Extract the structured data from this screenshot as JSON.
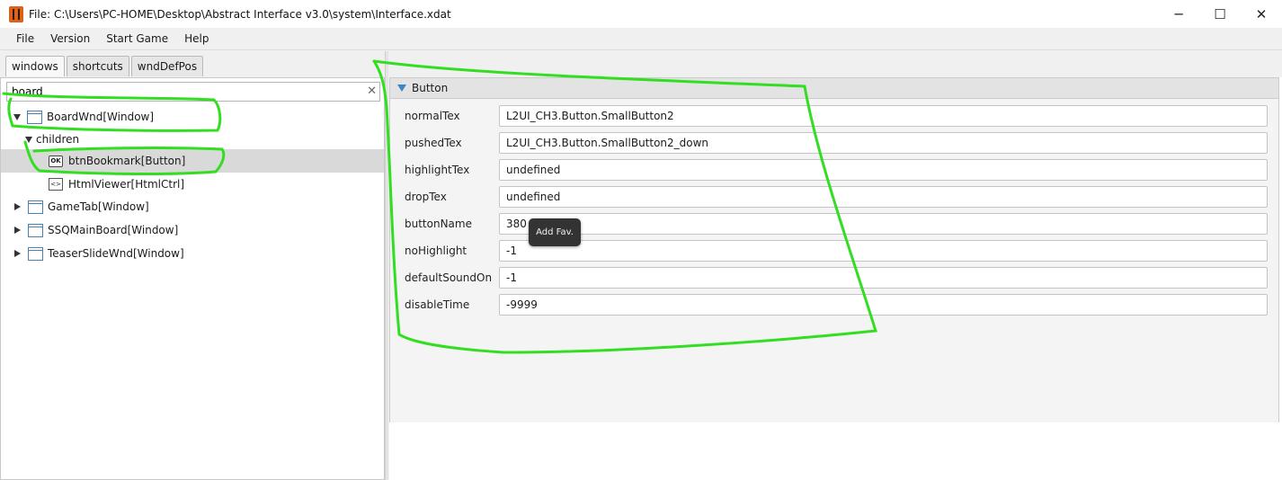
{
  "window": {
    "title": "File: C:\\Users\\PC-HOME\\Desktop\\Abstract Interface v3.0\\system\\Interface.xdat",
    "minimize": "─",
    "maximize": "☐",
    "close": "✕"
  },
  "menu": {
    "items": [
      {
        "label": "File"
      },
      {
        "label": "Version"
      },
      {
        "label": "Start Game"
      },
      {
        "label": "Help"
      }
    ]
  },
  "left": {
    "tabs": [
      {
        "label": "windows"
      },
      {
        "label": "shortcuts"
      },
      {
        "label": "wndDefPos"
      }
    ],
    "search": {
      "value": "board",
      "clear": "✕"
    },
    "tree": [
      {
        "label": "BoardWnd[Window]"
      },
      {
        "label": "children"
      },
      {
        "label": "btnBookmark[Button]",
        "icon_text": "OK"
      },
      {
        "label": "HtmlViewer[HtmlCtrl]",
        "icon_text": "<>"
      },
      {
        "label": "GameTab[Window]"
      },
      {
        "label": "SSQMainBoard[Window]"
      },
      {
        "label": "TeaserSlideWnd[Window]"
      }
    ]
  },
  "right": {
    "section_title": "Button",
    "properties": [
      {
        "name": "normalTex",
        "value": "L2UI_CH3.Button.SmallButton2"
      },
      {
        "name": "pushedTex",
        "value": "L2UI_CH3.Button.SmallButton2_down"
      },
      {
        "name": "highlightTex",
        "value": "undefined"
      },
      {
        "name": "dropTex",
        "value": "undefined"
      },
      {
        "name": "buttonName",
        "value": "380"
      },
      {
        "name": "noHighlight",
        "value": "-1"
      },
      {
        "name": "defaultSoundOn",
        "value": "-1"
      },
      {
        "name": "disableTime",
        "value": "-9999"
      }
    ],
    "tooltip": "Add Fav."
  },
  "colors": {
    "annotation_green": "#33dd22",
    "section_arrow": "#3a86c8"
  }
}
